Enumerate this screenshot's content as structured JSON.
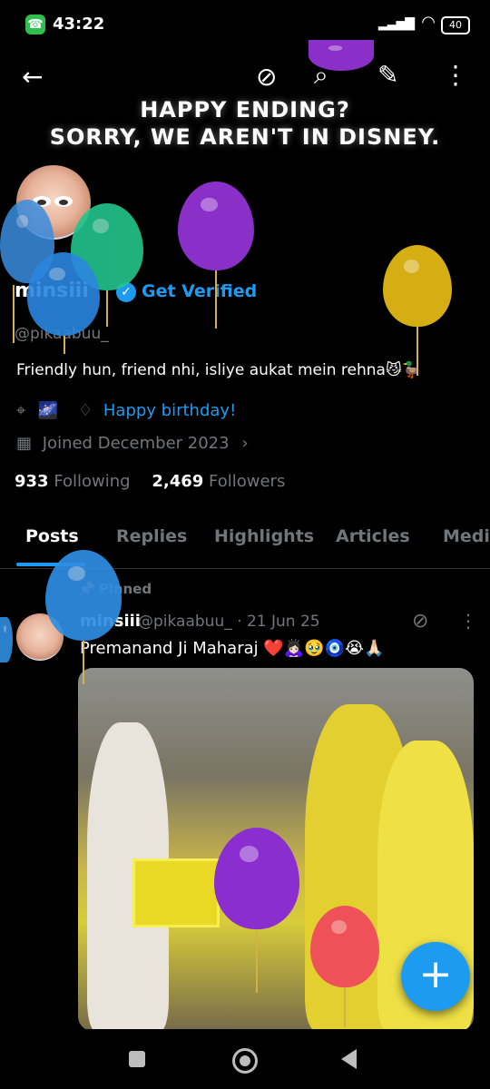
{
  "status_bar": {
    "time": "43:22",
    "battery": "40"
  },
  "header": {
    "banner_line1": "HAPPY ENDING?",
    "banner_line2": "SORRY, WE AREN'T IN DISNEY."
  },
  "profile": {
    "name": "minsiii",
    "verified_cta": "Get Verified",
    "handle": "@pikaabuu_",
    "bio": "Friendly hun, friend nhi, isliye aukat mein rehna😼🦆",
    "location": "🌌",
    "birthday": "Happy birthday!",
    "joined": "Joined December 2023",
    "following_count": "933",
    "following_label": "Following",
    "followers_count": "2,469",
    "followers_label": "Followers"
  },
  "tabs": [
    "Posts",
    "Replies",
    "Highlights",
    "Articles",
    "Media"
  ],
  "pinned_post": {
    "pinned_label": "Pinned",
    "author": "minsiii",
    "handle_date": "@pikaabuu_ · 21 Jun 25",
    "text": "Premanand Ji Maharaj ❤️🙇🏻‍♀️🥹🧿😭🙏🏻"
  },
  "fab": {
    "label": "+"
  },
  "colors": {
    "accent": "#1d9bf0",
    "background": "#000000",
    "muted": "#71767b"
  }
}
